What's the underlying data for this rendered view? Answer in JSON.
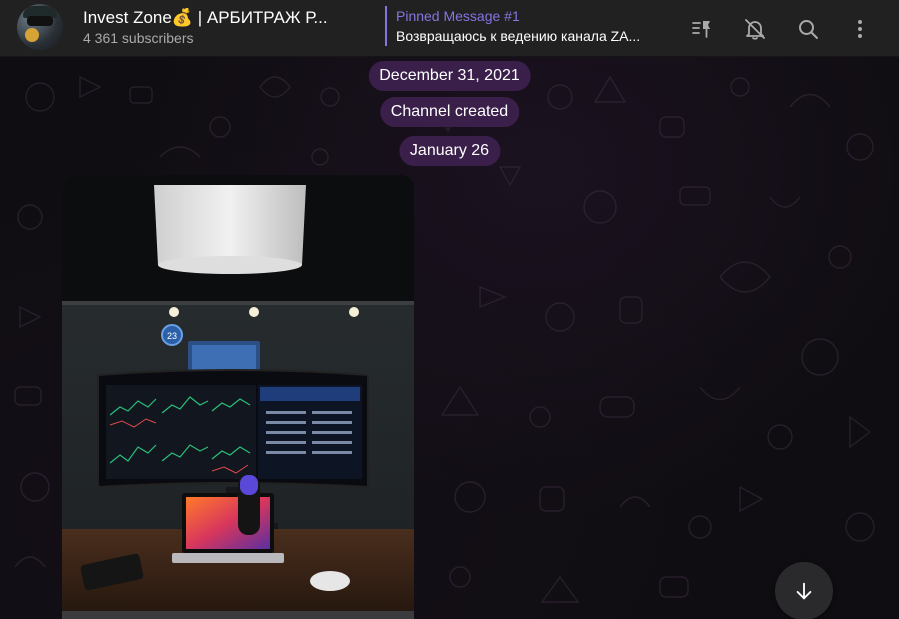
{
  "channel": {
    "title": "Invest Zone💰 | АРБИТРАЖ Р...",
    "subscribers": "4 361 subscribers"
  },
  "pinned": {
    "label": "Pinned Message #1",
    "text": "Возвращаюсь к ведению канала ZA..."
  },
  "header_icons": [
    "pinned-list-icon",
    "mute-bell-icon",
    "search-icon",
    "more-vertical-icon"
  ],
  "messages": {
    "date1": "December 31, 2021",
    "service": "Channel created",
    "date2": "January 26"
  },
  "photo": {
    "badge": "23"
  },
  "colors": {
    "accent": "#8774e1",
    "header_bg": "#212121",
    "pill_bg": "#3a1f4a"
  }
}
